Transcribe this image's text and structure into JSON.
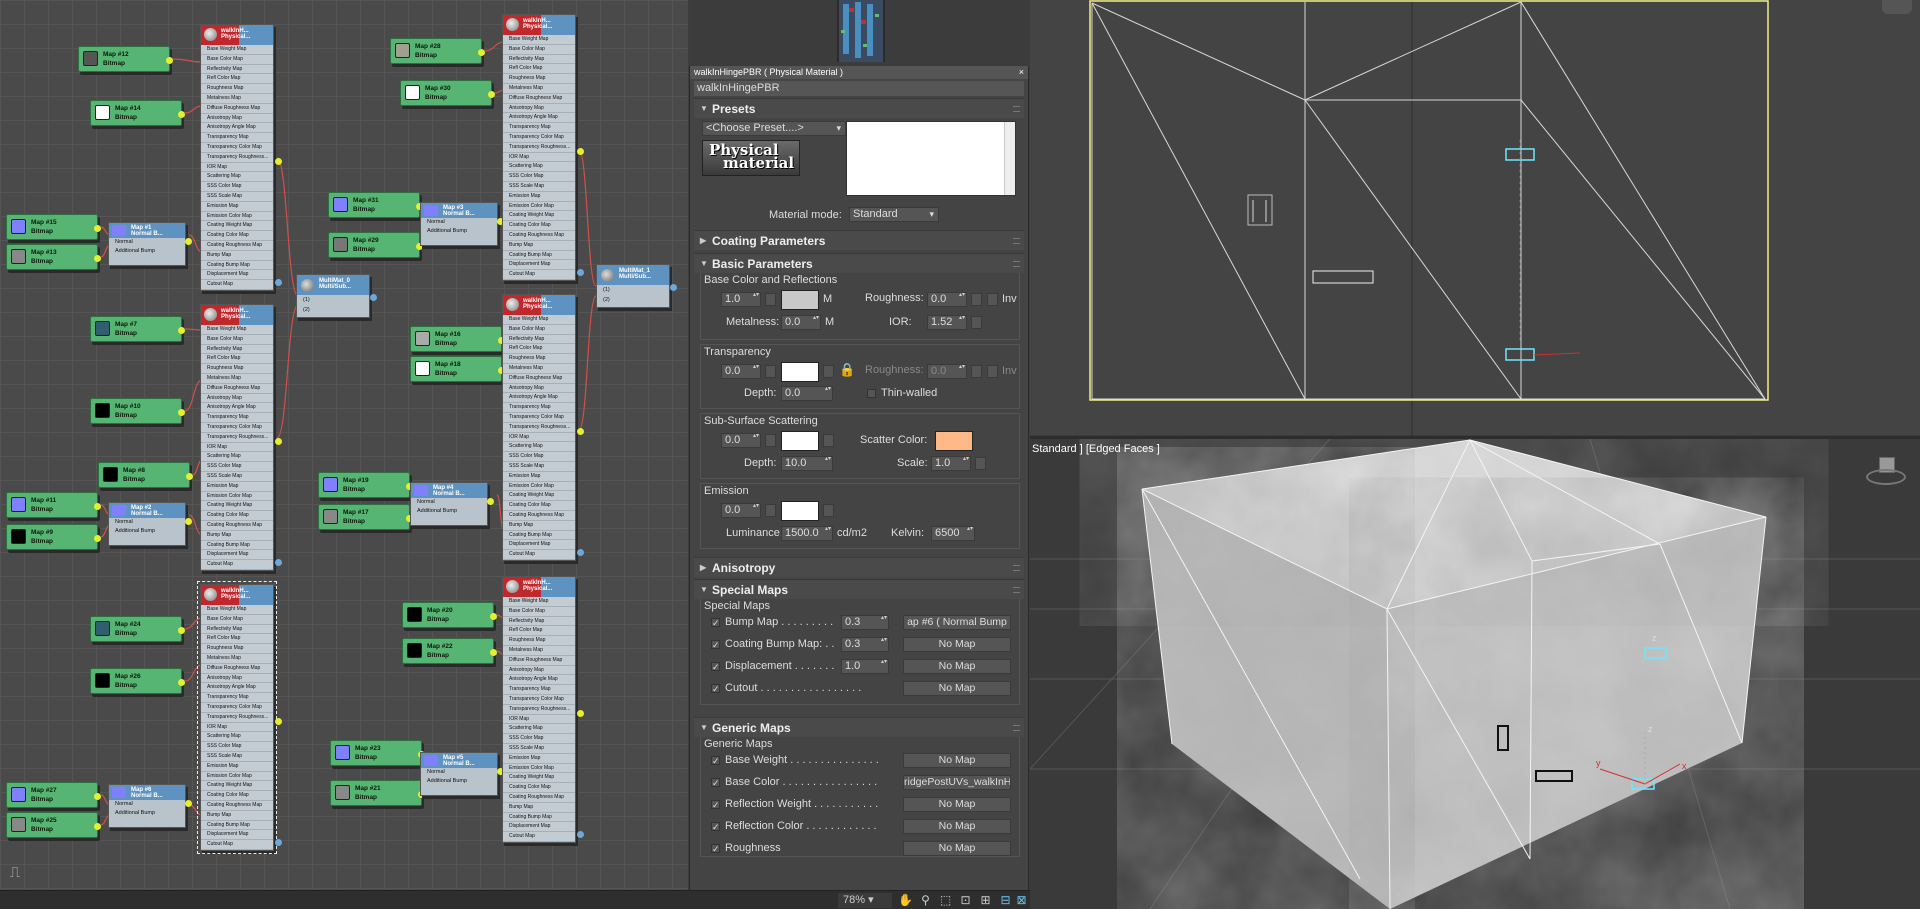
{
  "node_editor": {
    "bitmap_nodes": [
      {
        "title": "Map #12",
        "type": "Bitmap",
        "swatch": "#555555"
      },
      {
        "title": "Map #14",
        "type": "Bitmap",
        "swatch": "#ffffff"
      },
      {
        "title": "Map #15",
        "type": "Bitmap",
        "swatch": "#8080ff"
      },
      {
        "title": "Map #13",
        "type": "Bitmap",
        "swatch": "#888888"
      },
      {
        "title": "Map #7",
        "type": "Bitmap",
        "swatch": "#306070"
      },
      {
        "title": "Map #10",
        "type": "Bitmap",
        "swatch": "#000000"
      },
      {
        "title": "Map #8",
        "type": "Bitmap",
        "swatch": "#000000"
      },
      {
        "title": "Map #11",
        "type": "Bitmap",
        "swatch": "#8080ff"
      },
      {
        "title": "Map #9",
        "type": "Bitmap",
        "swatch": "#000000"
      },
      {
        "title": "Map #24",
        "type": "Bitmap",
        "swatch": "#306070"
      },
      {
        "title": "Map #26",
        "type": "Bitmap",
        "swatch": "#000000"
      },
      {
        "title": "Map #27",
        "type": "Bitmap",
        "swatch": "#8080ff"
      },
      {
        "title": "Map #25",
        "type": "Bitmap",
        "swatch": "#888888"
      },
      {
        "title": "Map #28",
        "type": "Bitmap",
        "swatch": "#a0a090"
      },
      {
        "title": "Map #30",
        "type": "Bitmap",
        "swatch": "#ffffff"
      },
      {
        "title": "Map #31",
        "type": "Bitmap",
        "swatch": "#8080ff"
      },
      {
        "title": "Map #29",
        "type": "Bitmap",
        "swatch": "#777777"
      },
      {
        "title": "Map #16",
        "type": "Bitmap",
        "swatch": "#aaaaaa"
      },
      {
        "title": "Map #18",
        "type": "Bitmap",
        "swatch": "#ffffff"
      },
      {
        "title": "Map #19",
        "type": "Bitmap",
        "swatch": "#8080ff"
      },
      {
        "title": "Map #17",
        "type": "Bitmap",
        "swatch": "#888888"
      },
      {
        "title": "Map #20",
        "type": "Bitmap",
        "swatch": "#000000"
      },
      {
        "title": "Map #22",
        "type": "Bitmap",
        "swatch": "#000000"
      },
      {
        "title": "Map #23",
        "type": "Bitmap",
        "swatch": "#8080ff"
      },
      {
        "title": "Map #21",
        "type": "Bitmap",
        "swatch": "#888888"
      }
    ],
    "normal_nodes": [
      {
        "title": "Map #1",
        "type": "Normal B..."
      },
      {
        "title": "Map #2",
        "type": "Normal B..."
      },
      {
        "title": "Map #6",
        "type": "Normal B..."
      },
      {
        "title": "Map #3",
        "type": "Normal B..."
      },
      {
        "title": "Map #4",
        "type": "Normal B..."
      },
      {
        "title": "Map #5",
        "type": "Normal B..."
      }
    ],
    "normal_slots": [
      "Normal",
      "Additional Bump"
    ],
    "physical_nodes": [
      {
        "title": "walkInH...",
        "type": "Physical..."
      },
      {
        "title": "walkInH...",
        "type": "Physical..."
      },
      {
        "title": "walkInH...",
        "type": "Physical..."
      },
      {
        "title": "walkInH...",
        "type": "Physical..."
      },
      {
        "title": "walkInH...",
        "type": "Physical..."
      },
      {
        "title": "walkInH...",
        "type": "Physical..."
      }
    ],
    "physical_slots": [
      "Base Weight Map",
      "Base Color Map",
      "Reflectivity Map",
      "Refl Color Map",
      "Roughness Map",
      "Metalness Map",
      "Diffuse Roughness Map",
      "Anisotropy Map",
      "Anisotropy Angle Map",
      "Transparency Map",
      "Transparency Color Map",
      "Transparency Roughness...",
      "IOR Map",
      "Scattering Map",
      "SSS Color Map",
      "SSS Scale Map",
      "Emission Map",
      "Emission Color Map",
      "Coating Weight Map",
      "Coating Color Map",
      "Coating Roughness Map",
      "Bump Map",
      "Coating Bump Map",
      "Displacement Map",
      "Cutout Map"
    ],
    "multi_nodes": [
      {
        "title": "MultiMat_0",
        "type": "Multi/Sub...",
        "slots": [
          "(1)",
          "(2)"
        ]
      },
      {
        "title": "MultiMat_1",
        "type": "Multi/Sub...",
        "slots": [
          "(1)",
          "(2)"
        ]
      }
    ],
    "zoom": "78%"
  },
  "material": {
    "title": "walkInHingePBR  ( Physical Material )",
    "name": "walkInHingePBR",
    "presets": {
      "label": "Presets",
      "dropdown": "<Choose Preset....>",
      "logo_line1": "Physical",
      "logo_line2": "material",
      "mode_label": "Material mode:",
      "mode_value": "Standard"
    },
    "coating": {
      "label": "Coating Parameters"
    },
    "basic": {
      "label": "Basic Parameters",
      "base": {
        "label": "Base Color and Reflections",
        "weight": "1.0",
        "color": "#c8c8c8",
        "m1": "M",
        "roughness_label": "Roughness:",
        "roughness": "0.0",
        "inv": "Inv",
        "metalness_label": "Metalness:",
        "metalness": "0.0",
        "m2": "M",
        "ior_label": "IOR:",
        "ior": "1.52"
      },
      "transparency": {
        "label": "Transparency",
        "weight": "0.0",
        "color": "#ffffff",
        "roughness_label": "Roughness:",
        "roughness": "0.0",
        "inv": "Inv",
        "depth_label": "Depth:",
        "depth": "0.0",
        "thin_walled": "Thin-walled"
      },
      "sss": {
        "label": "Sub-Surface Scattering",
        "weight": "0.0",
        "color": "#ffffff",
        "scatter_label": "Scatter Color:",
        "scatter_color": "#ffb888",
        "depth_label": "Depth:",
        "depth": "10.0",
        "scale_label": "Scale:",
        "scale": "1.0"
      },
      "emission": {
        "label": "Emission",
        "weight": "0.0",
        "color": "#ffffff",
        "luminance_label": "Luminance:",
        "luminance": "1500.0",
        "unit": "cd/m2",
        "kelvin_label": "Kelvin:",
        "kelvin": "6500"
      }
    },
    "anisotropy": {
      "label": "Anisotropy"
    },
    "special": {
      "label": "Special Maps",
      "sub": "Special Maps",
      "rows": [
        {
          "label": "Bump Map . . . . . . . . .",
          "amount": "0.3",
          "map": "ap #6  ( Normal Bump"
        },
        {
          "label": "Coating Bump Map: . .",
          "amount": "0.3",
          "map": "No Map"
        },
        {
          "label": "Displacement . . . . . . .",
          "amount": "1.0",
          "map": "No Map"
        },
        {
          "label": "Cutout . . . . . . . . . . . . . . . . .",
          "amount": "",
          "map": "No Map"
        }
      ]
    },
    "generic": {
      "label": "Generic Maps",
      "sub": "Generic Maps",
      "rows": [
        {
          "label": "Base Weight . . . . . . . . . . . . . . .",
          "map": "No Map"
        },
        {
          "label": "Base Color . . . . . . . . . . . . . . . .",
          "map": "ridgePostUVs_walkInHi"
        },
        {
          "label": "Reflection Weight . . . . . . . . . . .",
          "map": "No Map"
        },
        {
          "label": "Reflection Color . . . . . . . . . . . .",
          "map": "No Map"
        },
        {
          "label": "Roughness",
          "map": "No Map"
        }
      ]
    }
  },
  "viewport": {
    "perspective_label": "Standard ] [Edged Faces ]",
    "gizmo": {
      "x": "x",
      "y": "y",
      "z": "z"
    }
  },
  "colors": {
    "bitmap": "#57b574",
    "node_header": "#5e92c0",
    "physical_accent": "#c0282c",
    "selection": "#e6e6a0",
    "wire": "#d0504a"
  }
}
